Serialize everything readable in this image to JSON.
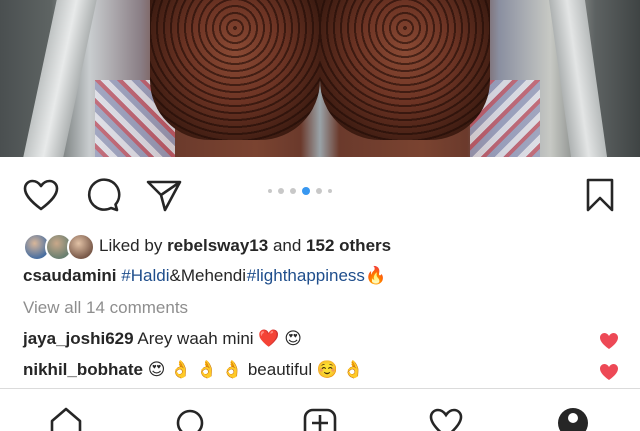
{
  "post": {
    "liked_by_prefix": "Liked by",
    "liked_by_user": "rebelsway13",
    "liked_by_and": "and",
    "liked_by_others": "152 others",
    "caption_user": "csaudamini",
    "caption_tag1": "#Haldi",
    "caption_mid": "&Mehendi",
    "caption_tag2": "#lighthappiness",
    "caption_emoji": "🔥",
    "view_all_comments": "View all 14 comments"
  },
  "comments": [
    {
      "user": "jaya_joshi629",
      "text": "Arey waah mini",
      "emoji": "❤️ 😍",
      "liked": true
    },
    {
      "user": "nikhil_bobhate",
      "text_pre_emoji": "😍  👌 👌 👌",
      "text": "beautiful",
      "emoji": "☺️ 👌",
      "liked": true
    }
  ],
  "carousel": {
    "count": 6,
    "active_index": 3
  },
  "colors": {
    "accent_blue": "#3897f0",
    "like_red": "#ed4956",
    "hashtag": "#1f4e8c",
    "muted": "#8e8e8e"
  },
  "icons": {
    "like": "heart-outline-icon",
    "comment": "speech-bubble-icon",
    "share": "paper-plane-icon",
    "save": "bookmark-icon",
    "tabs": [
      "home-icon",
      "search-icon",
      "add-post-icon",
      "activity-heart-icon",
      "profile-icon"
    ]
  }
}
